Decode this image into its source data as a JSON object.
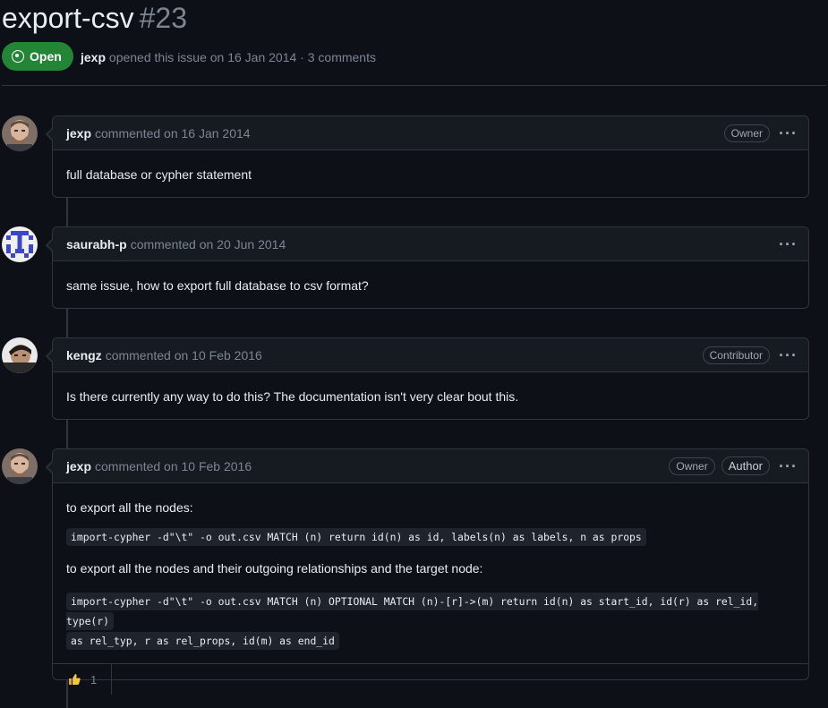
{
  "issue": {
    "title": "export-csv",
    "number": "#23",
    "state": "Open",
    "author": "jexp",
    "meta_text": "opened this issue on 16 Jan 2014 · 3 comments"
  },
  "comments": [
    {
      "author": "jexp",
      "when": "commented on 16 Jan 2014",
      "badges": [
        "Owner"
      ],
      "body": "full database or cypher statement"
    },
    {
      "author": "saurabh-p",
      "when": "commented on 20 Jun 2014",
      "badges": [],
      "body": "same issue, how to export full database to csv format?"
    },
    {
      "author": "kengz",
      "when": "commented on 10 Feb 2016",
      "badges": [
        "Contributor"
      ],
      "body": "Is there currently any way to do this? The documentation isn't very clear bout this."
    },
    {
      "author": "jexp",
      "when": "commented on 10 Feb 2016",
      "badges": [
        "Owner",
        "Author"
      ],
      "text1": "to export all the nodes:",
      "code1": "import-cypher -d\"\\t\" -o out.csv MATCH (n) return id(n) as id, labels(n) as labels, n as props",
      "text2": "to export all the nodes and their outgoing relationships and the target node:",
      "code2a": "import-cypher -d\"\\t\" -o out.csv MATCH (n) OPTIONAL MATCH (n)-[r]->(m) return id(n) as start_id, id(r) as rel_id, type(r)",
      "code2b": "as rel_typ, r as rel_props, id(m) as end_id",
      "reaction": {
        "icon": "thumbs-up",
        "count": "1"
      }
    }
  ],
  "more_icon": "···",
  "colors": {
    "open_green": "#238636",
    "bg": "#0d1117",
    "header_bg": "#161b22",
    "border": "#30363d"
  }
}
